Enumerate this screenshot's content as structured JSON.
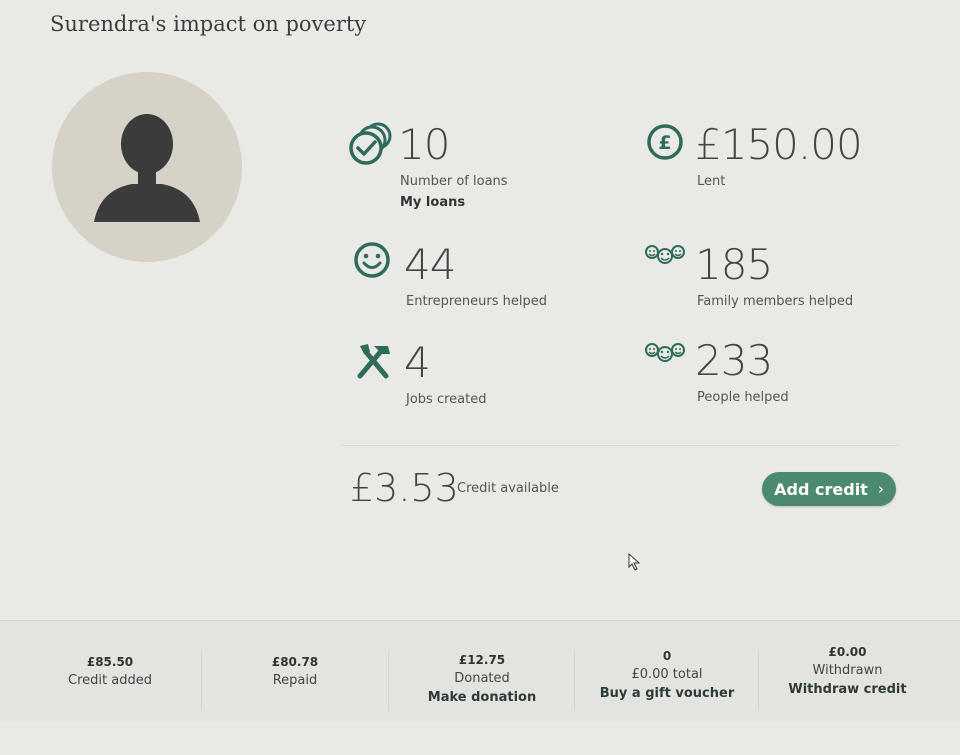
{
  "page": {
    "title": "Surendra's impact on poverty"
  },
  "colors": {
    "accent": "#4c8a6f",
    "icon": "#2f6b5a"
  },
  "stats": {
    "loans": {
      "value": "10",
      "label": "Number of loans",
      "link": "My loans",
      "icon": "coins-check-icon"
    },
    "lent": {
      "value": "£150.00",
      "label": "Lent",
      "icon": "pound-coin-icon"
    },
    "entrepreneurs": {
      "value": "44",
      "label": "Entrepreneurs helped",
      "icon": "smiley-icon"
    },
    "family": {
      "value": "185",
      "label": "Family members helped",
      "icon": "family-smileys-icon"
    },
    "jobs": {
      "value": "4",
      "label": "Jobs created",
      "icon": "tools-icon"
    },
    "people": {
      "value": "233",
      "label": "People helped",
      "icon": "people-smileys-icon"
    }
  },
  "credit": {
    "value": "£3.53",
    "label": "Credit available",
    "button": "Add credit"
  },
  "summary": [
    {
      "value": "£85.50",
      "label": "Credit added"
    },
    {
      "value": "£80.78",
      "label": "Repaid"
    },
    {
      "value": "£12.75",
      "label": "Donated",
      "link": "Make donation"
    },
    {
      "value": "0",
      "label": "£0.00 total",
      "link": "Buy a gift voucher"
    },
    {
      "value": "£0.00",
      "label": "Withdrawn",
      "link": "Withdraw credit"
    }
  ]
}
